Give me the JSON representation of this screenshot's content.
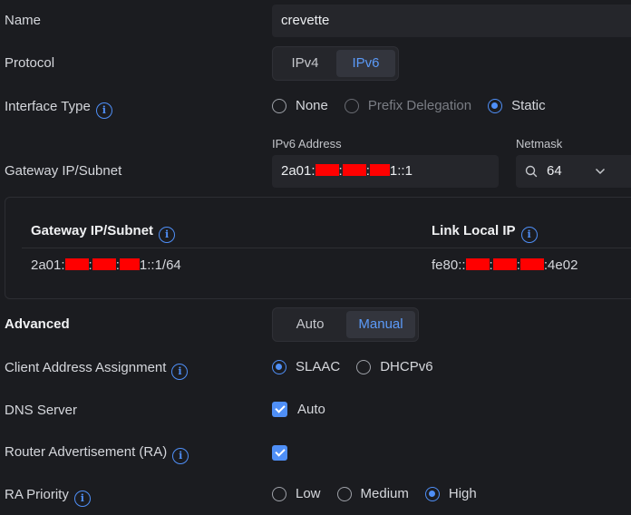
{
  "name": {
    "label": "Name",
    "value": "crevette"
  },
  "protocol": {
    "label": "Protocol",
    "options": [
      "IPv4",
      "IPv6"
    ],
    "selected": "IPv6"
  },
  "interface_type": {
    "label": "Interface Type",
    "options": [
      {
        "label": "None",
        "state": "unselected"
      },
      {
        "label": "Prefix Delegation",
        "state": "disabled"
      },
      {
        "label": "Static",
        "state": "selected"
      }
    ]
  },
  "gateway": {
    "label": "Gateway IP/Subnet",
    "ipv6_address_label": "IPv6 Address",
    "ipv6_address_prefix": "2a01:",
    "ipv6_address_sep1": ":",
    "ipv6_address_sep2": ":",
    "ipv6_address_suffix": "1::1",
    "netmask_label": "Netmask",
    "netmask_value": "64"
  },
  "table": {
    "col1_header": "Gateway IP/Subnet",
    "col2_header": "Link Local IP",
    "row": {
      "gw_prefix": "2a01:",
      "gw_sep1": ":",
      "gw_sep2": ":",
      "gw_suffix": "1::1/64",
      "ll_prefix": "fe80::",
      "ll_sep1": ":",
      "ll_sep2": ":",
      "ll_suffix": ":4e02"
    }
  },
  "advanced": {
    "label": "Advanced",
    "options": [
      "Auto",
      "Manual"
    ],
    "selected": "Manual"
  },
  "client_address": {
    "label": "Client Address Assignment",
    "options": [
      {
        "label": "SLAAC",
        "state": "selected"
      },
      {
        "label": "DHCPv6",
        "state": "unselected"
      }
    ]
  },
  "dns": {
    "label": "DNS Server",
    "checkbox_label": "Auto",
    "checked": true
  },
  "router_adv": {
    "label": "Router Advertisement (RA)",
    "checked": true
  },
  "ra_priority": {
    "label": "RA Priority",
    "options": [
      {
        "label": "Low",
        "state": "unselected"
      },
      {
        "label": "Medium",
        "state": "unselected"
      },
      {
        "label": "High",
        "state": "selected"
      }
    ]
  },
  "colors": {
    "accent": "#4f8ff7",
    "background": "#1b1c20",
    "field": "#25262b",
    "redaction": "#ff0000"
  },
  "icons": [
    "info-icon",
    "search-icon",
    "chevron-down-icon",
    "check-icon"
  ]
}
